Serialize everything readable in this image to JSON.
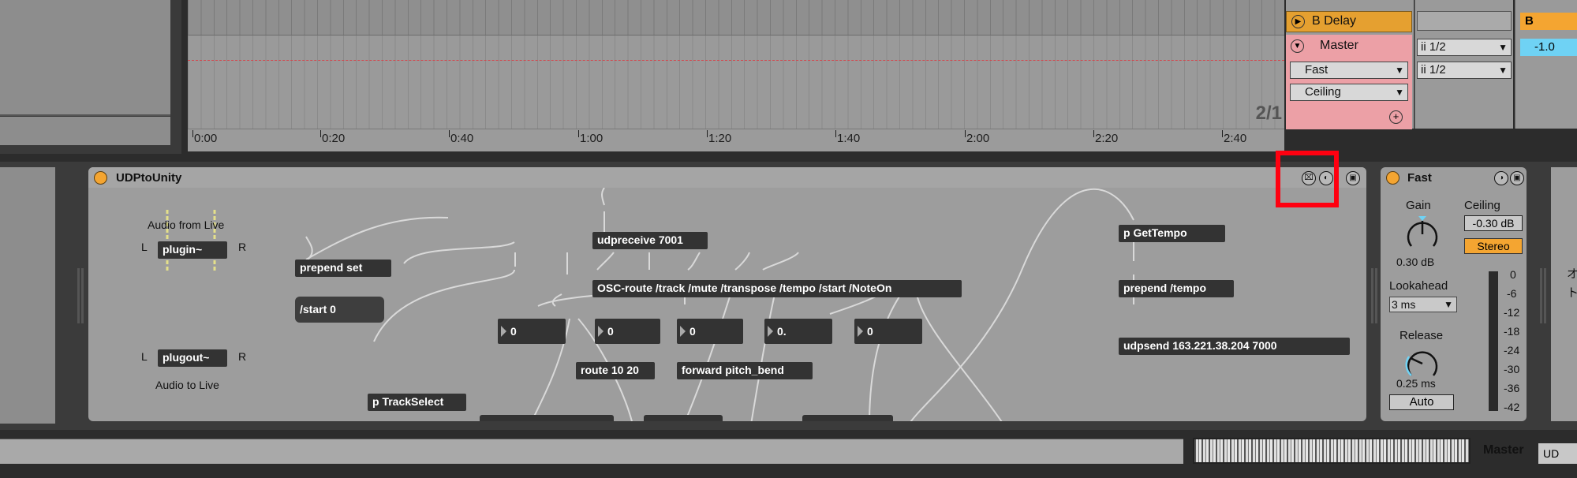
{
  "arrangement": {
    "ruler_ticks": [
      "0:00",
      "0:20",
      "0:40",
      "1:00",
      "1:20",
      "1:40",
      "2:00",
      "2:20",
      "2:40"
    ],
    "loop_label": "2/1"
  },
  "mixer": {
    "bdelay_label": "B Delay",
    "master_label": "Master",
    "limiter_mode": "Fast",
    "limiter_ceiling_mode": "Ceiling",
    "input_a": "ii 1/2",
    "input_b": "ii 1/2",
    "send_b": "B",
    "volume": "-1.0"
  },
  "device": {
    "title": "UDPtoUnity",
    "audio_from_live": "Audio from Live",
    "audio_to_live": "Audio to Live",
    "ch_l": "L",
    "ch_r": "R",
    "objects": {
      "plugin": "plugin~",
      "plugout": "plugout~",
      "prepend_set": "prepend set",
      "start_msg": "/start 0",
      "udpreceive": "udpreceive 7001",
      "osc_route": "OSC-route /track /mute /transpose /tempo /start /NoteOn",
      "route": "route 10 20",
      "forward": "forward pitch_bend",
      "track_select": "p TrackSelect",
      "get_tempo": "p GetTempo",
      "prepend_tempo": "prepend /tempo",
      "udpsend": "udpsend 163.221.38.204 7000"
    },
    "numboxes": [
      "0",
      "0",
      "0",
      "0.",
      "0"
    ]
  },
  "fast_device": {
    "title": "Fast",
    "gain_label": "Gain",
    "gain_value": "0.30 dB",
    "ceiling_label": "Ceiling",
    "ceiling_value": "-0.30 dB",
    "stereo_label": "Stereo",
    "lookahead_label": "Lookahead",
    "lookahead_value": "3 ms",
    "release_label": "Release",
    "release_value": "0.25 ms",
    "auto_label": "Auto",
    "meter_scale": [
      "0",
      "-6",
      "-12",
      "-18",
      "-24",
      "-30",
      "-36",
      "-42"
    ],
    "side_text": [
      "オ",
      "ト"
    ]
  },
  "footer": {
    "master_tab": "Master",
    "ud_tab": "UD"
  },
  "colors": {
    "power_on": "#f4a531",
    "highlight": "#ff0010",
    "bdelay": "#e5a030",
    "master": "#eca0a6",
    "stereo": "#f4a531",
    "volume": "#6fd2f4"
  }
}
